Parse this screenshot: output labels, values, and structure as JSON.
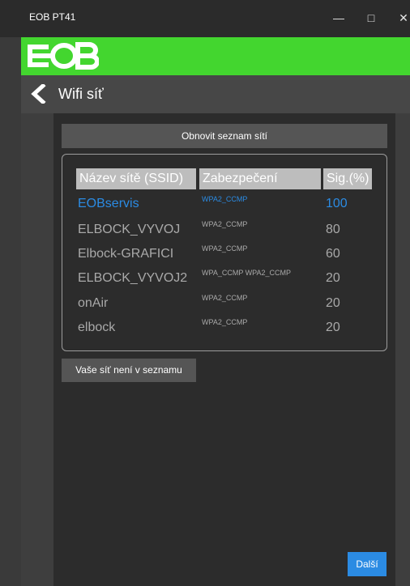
{
  "window": {
    "title": "EOB PT41",
    "minimize": "—",
    "maximize": "□",
    "close": "✕"
  },
  "brand": {
    "logo_alt": "EOB"
  },
  "header": {
    "title": "Wifi síť"
  },
  "refresh_label": "Obnovit seznam sítí",
  "table": {
    "columns": [
      "Název sítě (SSID)",
      "Zabezpečení",
      "Sig.(%)"
    ],
    "rows": [
      {
        "ssid": "EOBservis",
        "security": "WPA2_CCMP",
        "signal": "100"
      },
      {
        "ssid": "ELBOCK_VYVOJ",
        "security": "WPA2_CCMP",
        "signal": "80"
      },
      {
        "ssid": "Elbock-GRAFICI",
        "security": "WPA2_CCMP",
        "signal": "60"
      },
      {
        "ssid": "ELBOCK_VYVOJ2",
        "security": "WPA_CCMP WPA2_CCMP",
        "signal": "20"
      },
      {
        "ssid": "onAir",
        "security": "WPA2_CCMP",
        "signal": "20"
      },
      {
        "ssid": "elbock",
        "security": "WPA2_CCMP",
        "signal": "20"
      }
    ]
  },
  "not_listed_label": "Vaše síť není v seznamu",
  "next_label": "Další",
  "colors": {
    "accent": "#43d62f",
    "selected": "#2b8be3"
  }
}
